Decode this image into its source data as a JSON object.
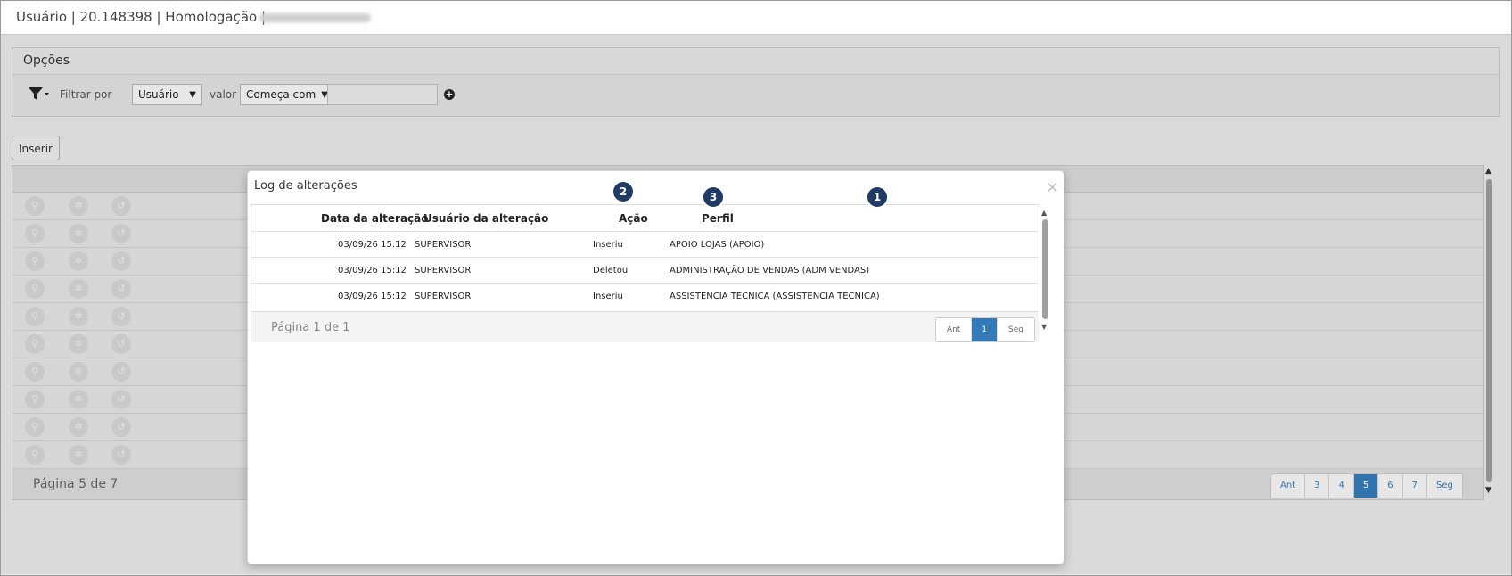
{
  "header": {
    "title": "Usuário | 20.148398 | Homologação |"
  },
  "options": {
    "title": "Opções",
    "filter_by_label": "Filtrar por",
    "filter_field": "Usuário",
    "value_label": "valor",
    "operator": "Começa com",
    "value": ""
  },
  "toolbar": {
    "insert_label": "Inserir"
  },
  "grid": {
    "page_info": "Página 5 de 7",
    "pager": [
      "Ant",
      "3",
      "4",
      "5",
      "6",
      "7",
      "Seg"
    ],
    "active_page": "5"
  },
  "modal": {
    "title": "Log de alterações",
    "close": "×",
    "columns": [
      "Data da alteração",
      "Usuário da alteração",
      "Ação",
      "Perfil"
    ],
    "rows": [
      [
        "03/09/26 15:12",
        "SUPERVISOR",
        "Inseriu",
        "APOIO LOJAS (APOIO)"
      ],
      [
        "03/09/26 15:12",
        "SUPERVISOR",
        "Deletou",
        "ADMINISTRAÇÃO DE VENDAS (ADM VENDAS)"
      ],
      [
        "03/09/26 15:12",
        "SUPERVISOR",
        "Inseriu",
        "ASSISTENCIA TECNICA (ASSISTENCIA TECNICA)"
      ]
    ],
    "page_info": "Página 1 de 1",
    "pager": [
      "Ant",
      "1",
      "Seg"
    ],
    "active_page": "1",
    "badges": [
      "1",
      "2",
      "3"
    ]
  },
  "colors": {
    "accent": "#337ab7",
    "badge": "#1f3b66"
  }
}
